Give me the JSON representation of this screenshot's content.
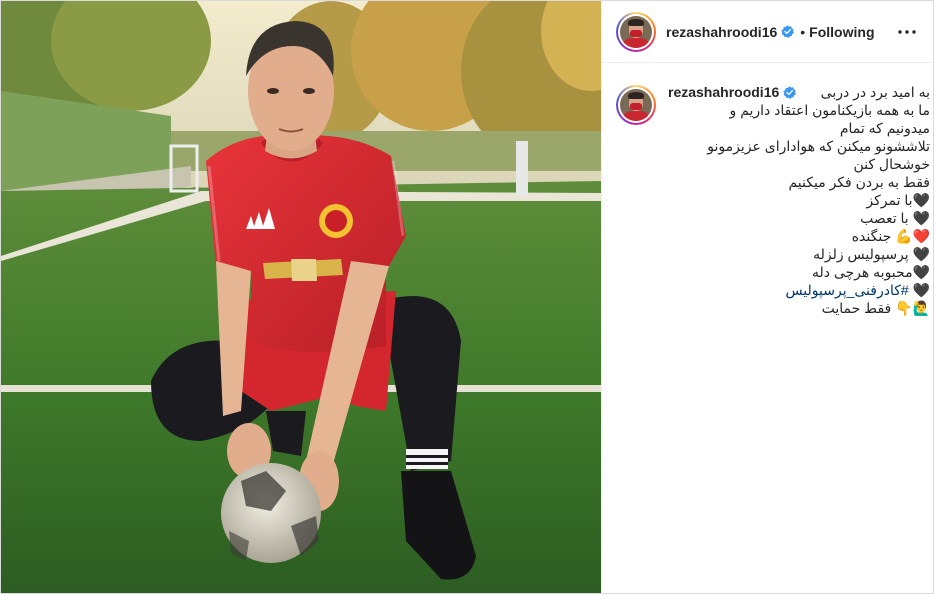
{
  "post": {
    "username": "rezashahroodi16",
    "follow_state": "Following",
    "separator": "•"
  },
  "caption": {
    "username": "rezashahroodi16",
    "lines": [
      "به امید برد در دربی",
      "ما به همه بازیکنامون اعتقاد داریم و",
      "میدونیم که تمام",
      "تلاششونو میکنن که هوادارای عزیزمونو",
      "خوشحال کنن",
      "فقط به بردن فکر میکنیم",
      "🖤با تمرکز",
      "🖤 با تعصب",
      "❤️💪 جنگنده",
      "🖤 پرسپولیس زلزله",
      "🖤محبوبه هرچی دله",
      "🖤 #کادرفنی_پرسپولیس",
      "🙋‍♂️👇 فقط حمایت"
    ],
    "hashtag": "#کادرفنی_پرسپولیس"
  },
  "photo": {
    "kit_sponsor": "CHEVROLET",
    "kit_brand": "adidas"
  },
  "icons": {
    "verified": "verified-badge-icon",
    "more": "more-options-icon"
  },
  "colors": {
    "verified_blue": "#3897f0",
    "hashtag_blue": "#00376b",
    "jersey_red": "#d92a30"
  }
}
